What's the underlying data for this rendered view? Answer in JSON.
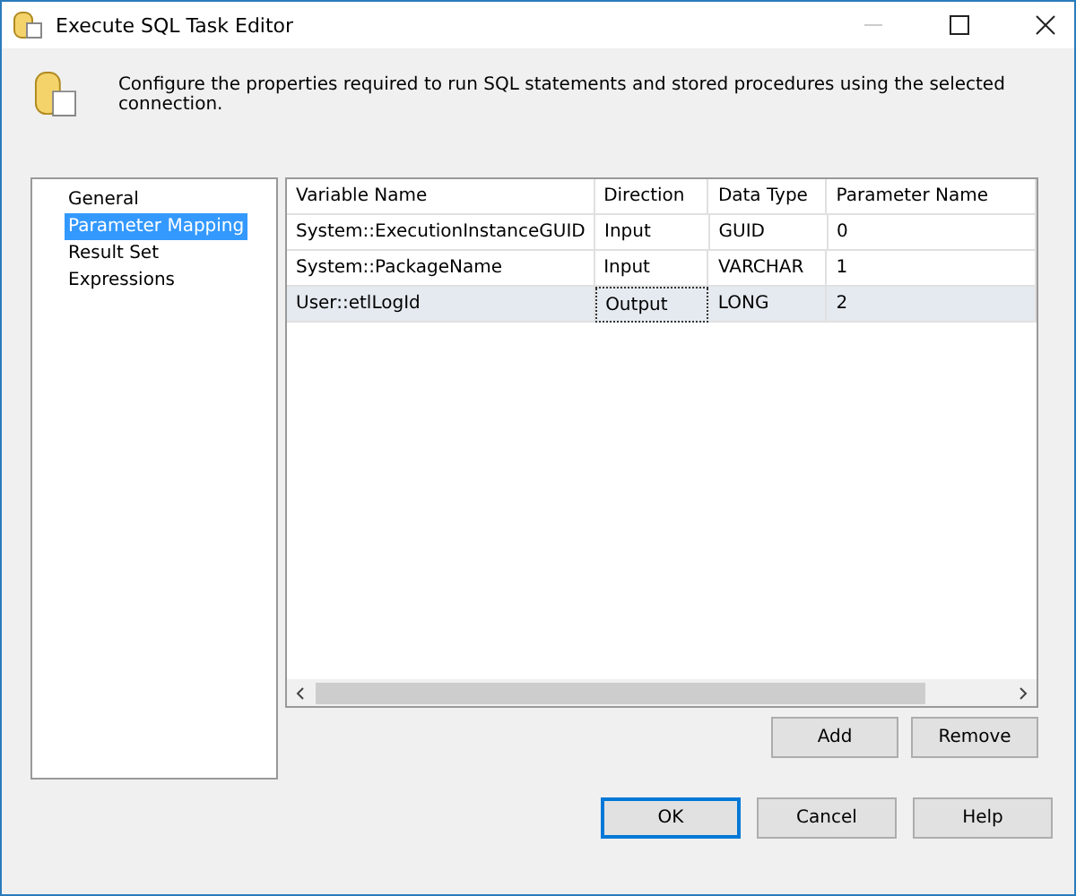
{
  "window": {
    "title": "Execute SQL Task Editor"
  },
  "description": "Configure the properties required to run SQL statements and stored procedures using the selected connection.",
  "sidebar": {
    "items": [
      {
        "label": "General",
        "selected": false
      },
      {
        "label": "Parameter Mapping",
        "selected": true
      },
      {
        "label": "Result Set",
        "selected": false
      },
      {
        "label": "Expressions",
        "selected": false
      }
    ]
  },
  "table": {
    "columns": [
      "Variable Name",
      "Direction",
      "Data Type",
      "Parameter Name"
    ],
    "rows": [
      {
        "selected": false,
        "cells": [
          {
            "text": "System::ExecutionInstanceGUID",
            "focused": false
          },
          {
            "text": "Input",
            "focused": false
          },
          {
            "text": "GUID",
            "focused": false
          },
          {
            "text": "0",
            "focused": false
          }
        ]
      },
      {
        "selected": false,
        "cells": [
          {
            "text": "System::PackageName",
            "focused": false
          },
          {
            "text": "Input",
            "focused": false
          },
          {
            "text": "VARCHAR",
            "focused": false
          },
          {
            "text": "1",
            "focused": false
          }
        ]
      },
      {
        "selected": true,
        "cells": [
          {
            "text": "User::etlLogId",
            "focused": false
          },
          {
            "text": "Output",
            "focused": true
          },
          {
            "text": "LONG",
            "focused": false
          },
          {
            "text": "2",
            "focused": false
          }
        ]
      }
    ]
  },
  "grid_buttons": [
    "Add",
    "Remove"
  ],
  "dialog_buttons": [
    {
      "label": "OK",
      "default": true
    },
    {
      "label": "Cancel",
      "default": false
    },
    {
      "label": "Help",
      "default": false
    }
  ]
}
